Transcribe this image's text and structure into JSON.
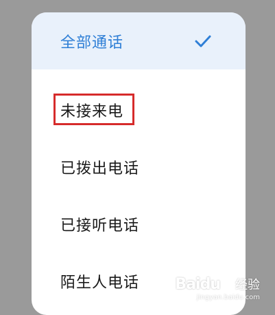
{
  "menu": {
    "items": [
      {
        "label": "全部通话",
        "selected": true
      },
      {
        "label": "未接来电",
        "selected": false
      },
      {
        "label": "已拨出电话",
        "selected": false
      },
      {
        "label": "已接听电话",
        "selected": false
      },
      {
        "label": "陌生人电话",
        "selected": false
      }
    ],
    "selected_icon": "checkmark-icon",
    "accent_color": "#2f7fd6",
    "selected_bg": "#e9f1fb"
  },
  "annotation": {
    "highlight_color": "#d62b2b"
  },
  "watermark": {
    "brand": "Baidu",
    "tail": "经验",
    "sub": "jingyan.baidu.com"
  }
}
